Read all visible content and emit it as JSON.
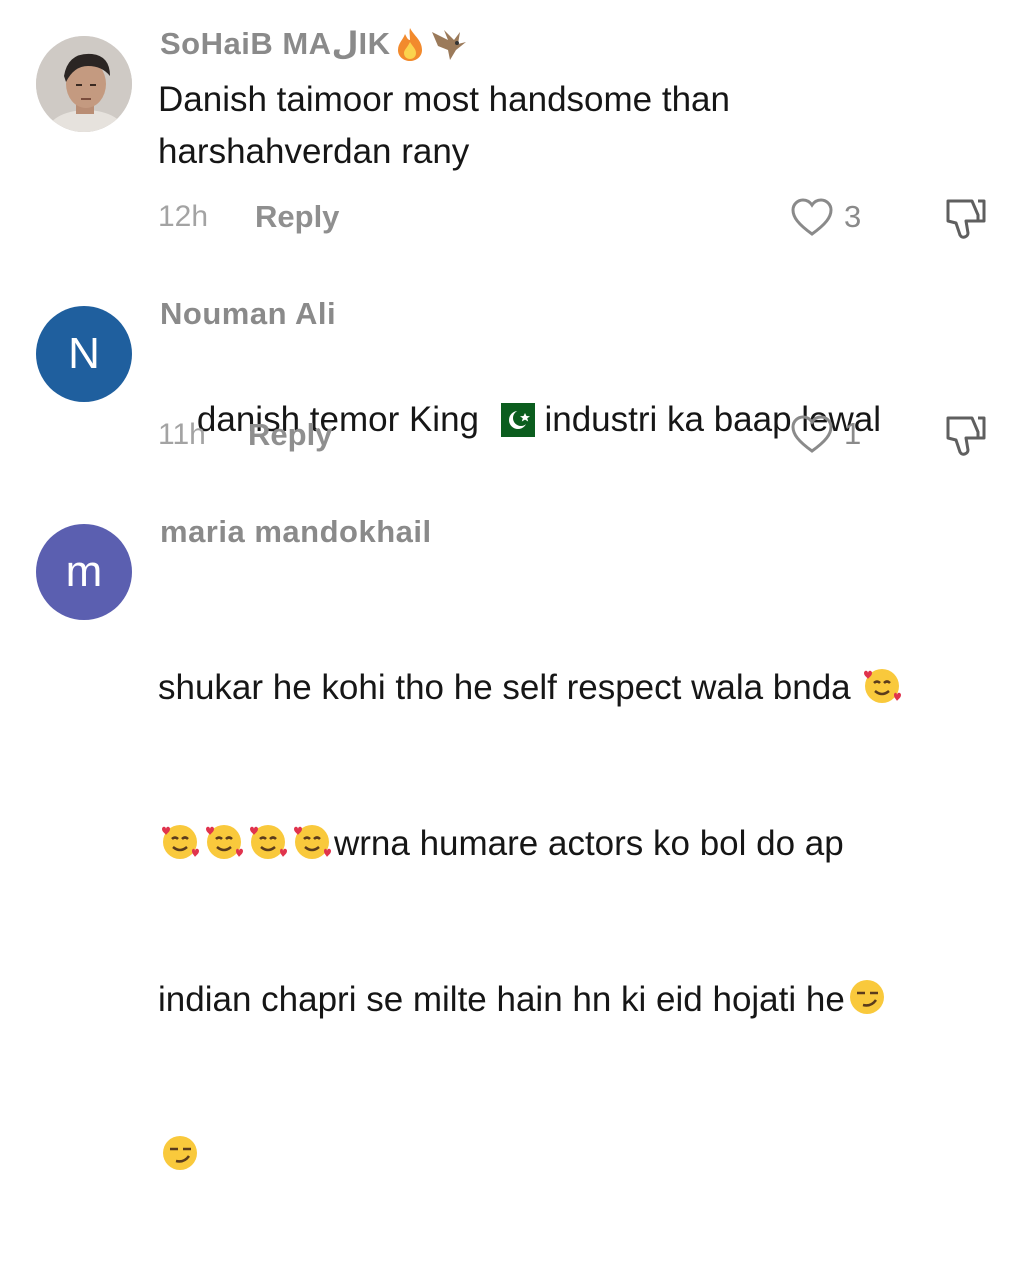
{
  "comments": [
    {
      "username": "SoHaiB MAلIK",
      "username_emojis": [
        "fire-emoji",
        "eagle-emoji"
      ],
      "text": "Danish taimoor most handsome than\nharshahverdan rany",
      "time": "12h",
      "reply": "Reply",
      "likes": "3",
      "avatar": "photo"
    },
    {
      "username": "Nouman Ali",
      "text_before_flag": "danish temor King ",
      "text_after_flag": " industri ka baap lewal",
      "time": "11h",
      "reply": "Reply",
      "likes": "1",
      "avatar_letter": "N"
    },
    {
      "username": "maria mandokhail",
      "line1": "shukar he kohi tho he self respect wala bnda ",
      "line2": "wrna humare actors ko bol do ap",
      "line3": "indian chapri se milte hain hn ki eid hojati he",
      "avatar_letter": "m"
    }
  ],
  "colors": {
    "avatar_n": "#1f5f9e",
    "avatar_m": "#5b5fb0",
    "muted": "#8a8a8a"
  }
}
